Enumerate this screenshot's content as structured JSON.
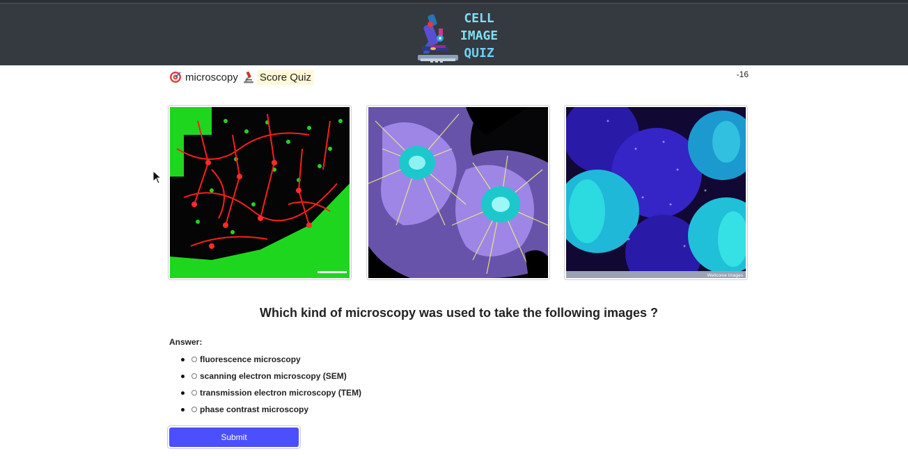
{
  "header": {
    "logo_lines": [
      "CELL",
      "IMAGE",
      "QUIZ"
    ],
    "logo_colors": {
      "cell": "#7ee0f5",
      "image": "#7ee0f5",
      "quiz": "#6fd0f2"
    }
  },
  "toolbar": {
    "mode_label": "microscopy",
    "score_quiz_label": "Score Quiz",
    "score_value": "-16"
  },
  "images": [
    {
      "name": "fluorescence-neurons-image",
      "colors": [
        "#ff1a1a",
        "#22e022",
        "#000000"
      ]
    },
    {
      "name": "fluorescence-cells-image",
      "colors": [
        "#22d8d8",
        "#e8e85a",
        "#8a6ee0"
      ]
    },
    {
      "name": "fluorescence-embryos-image",
      "colors": [
        "#20e0e0",
        "#3a2ad8",
        "#1a0a4a"
      ],
      "watermark": "Wellcome Images"
    }
  ],
  "question": "Which kind of microscopy was used to take the following images ?",
  "answer_label": "Answer:",
  "options": [
    "fluorescence microscopy",
    "scanning electron microscopy (SEM)",
    "transmission electron microscopy (TEM)",
    "phase contrast microscopy"
  ],
  "submit_label": "Submit",
  "colors": {
    "header_bg": "#343a40",
    "accent": "#4b4ffc",
    "highlight_bg": "#fff8d6"
  }
}
